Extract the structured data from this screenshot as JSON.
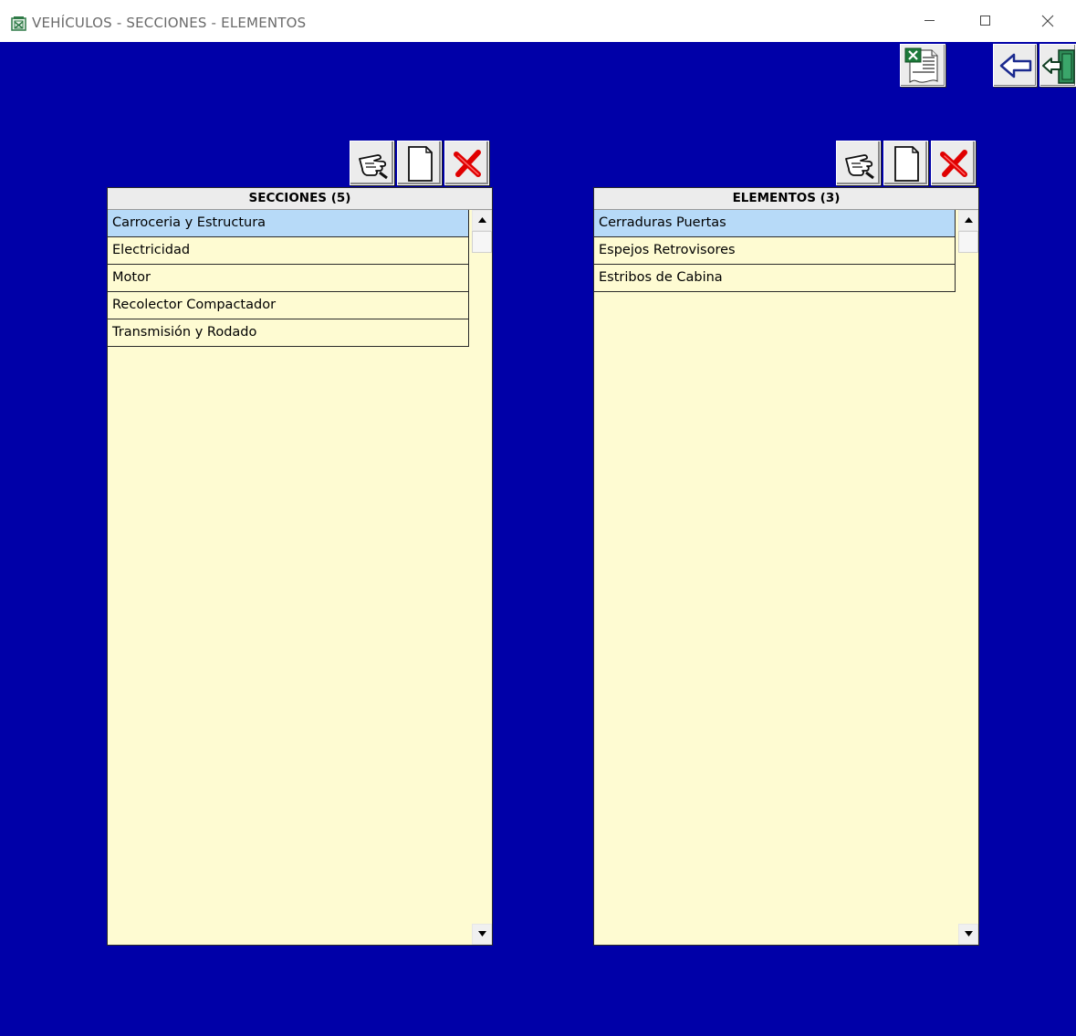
{
  "window": {
    "title": "VEHÍCULOS  -  SECCIONES  -  ELEMENTOS",
    "icon": "app-form-icon",
    "controls": [
      "minimize-icon",
      "maximize-icon",
      "close-icon"
    ]
  },
  "toolbar_top": {
    "buttons": [
      {
        "name": "export-excel-button",
        "icon": "excel-report-icon"
      },
      {
        "name": "back-button",
        "icon": "left-arrow-icon"
      },
      {
        "name": "exit-button",
        "icon": "exit-door-icon"
      }
    ]
  },
  "secciones": {
    "header": "SECCIONES  (5)",
    "tools": [
      "edit-hand-icon",
      "new-document-icon",
      "delete-x-icon"
    ],
    "items": [
      {
        "label": "Carroceria y Estructura",
        "selected": true
      },
      {
        "label": "Electricidad",
        "selected": false
      },
      {
        "label": "Motor",
        "selected": false
      },
      {
        "label": "Recolector Compactador",
        "selected": false
      },
      {
        "label": "Transmisión y Rodado",
        "selected": false
      }
    ]
  },
  "elementos": {
    "header": "ELEMENTOS  (3)",
    "tools": [
      "edit-hand-icon",
      "new-document-icon",
      "delete-x-icon"
    ],
    "items": [
      {
        "label": "Cerraduras Puertas",
        "selected": true
      },
      {
        "label": "Espejos Retrovisores",
        "selected": false
      },
      {
        "label": "Estribos de Cabina",
        "selected": false
      }
    ]
  },
  "colors": {
    "background": "#0000a8",
    "list_background": "#fefbd2",
    "selected_row": "#b7daf8",
    "delete_red": "#e00000"
  }
}
